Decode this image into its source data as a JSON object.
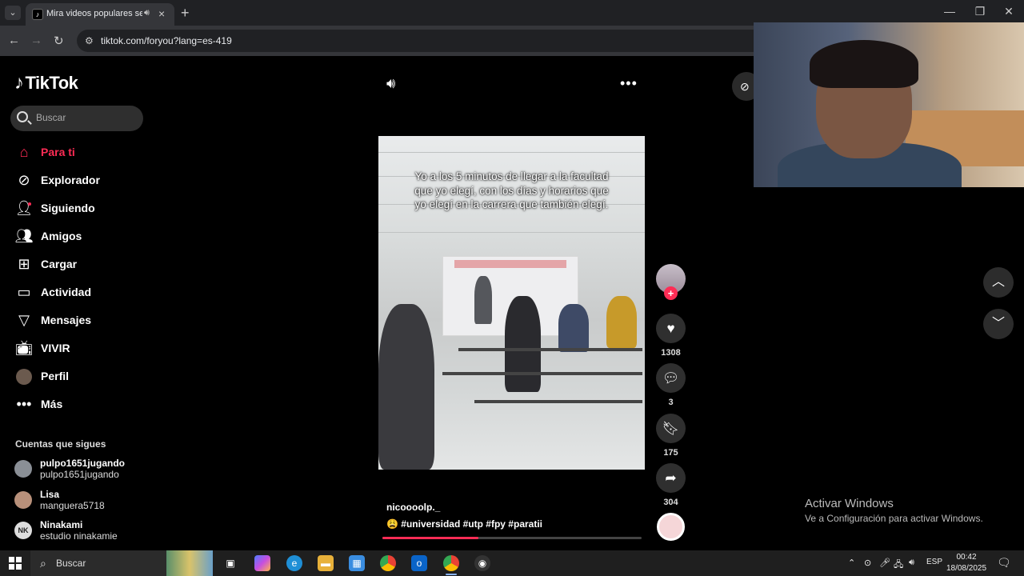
{
  "browser": {
    "tab_title": "Mira videos populares sele",
    "url": "tiktok.com/foryou?lang=es-419"
  },
  "tiktok": {
    "logo_text": "TikTok",
    "search_placeholder": "Buscar",
    "nav": [
      {
        "label": "Para ti",
        "icon": "home-icon",
        "active": true
      },
      {
        "label": "Explorador",
        "icon": "compass-icon"
      },
      {
        "label": "Siguiendo",
        "icon": "user-follow-icon"
      },
      {
        "label": "Amigos",
        "icon": "friends-icon"
      },
      {
        "label": "Cargar",
        "icon": "upload-icon"
      },
      {
        "label": "Actividad",
        "icon": "activity-icon"
      },
      {
        "label": "Mensajes",
        "icon": "messages-icon"
      },
      {
        "label": "VIVIR",
        "icon": "live-icon"
      },
      {
        "label": "Perfil",
        "icon": "profile-avatar"
      },
      {
        "label": "Más",
        "icon": "more-icon"
      }
    ],
    "following_heading": "Cuentas que sigues",
    "following": [
      {
        "name": "pulpo1651jugando",
        "handle": "pulpo1651jugando"
      },
      {
        "name": "Lisa",
        "handle": "manguera5718"
      },
      {
        "name": "Ninakami",
        "handle": "estudio ninakamie",
        "initials": "NK"
      }
    ],
    "video": {
      "overlay_text": "Yo a los 5 minutos de llegar a la facultad que yo elegí, con los días y horarios que yo elegí en la carrera que también elegí.",
      "author": "nicoooolp._",
      "caption": "😩 #universidad #utp #fpy #paratii",
      "progress": 0.37
    },
    "actions": {
      "likes": "1308",
      "comments": "3",
      "saves": "175",
      "shares": "304"
    }
  },
  "watermark": {
    "line1": "Activar Windows",
    "line2": "Ve a Configuración para activar Windows."
  },
  "taskbar": {
    "search_label": "Buscar",
    "language": "ESP",
    "time": "00:42",
    "date": "18/08/2025"
  },
  "colors": {
    "accent": "#fe2c55",
    "background": "#000000"
  }
}
